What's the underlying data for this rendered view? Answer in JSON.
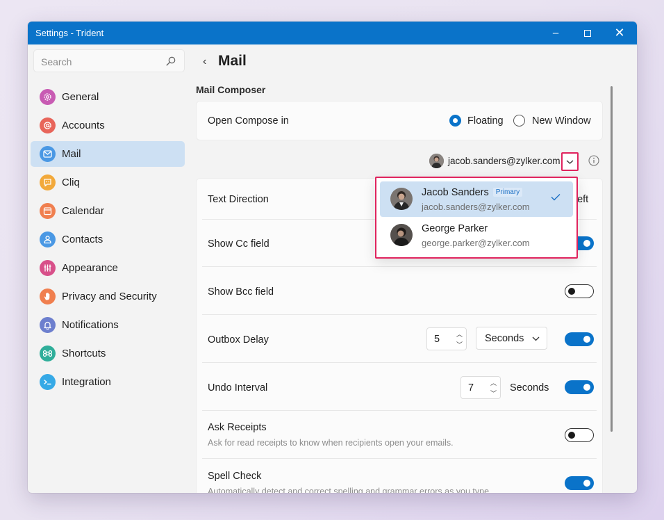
{
  "window": {
    "title": "Settings - Trident",
    "minimize": "–",
    "maximize": "",
    "close": "✕"
  },
  "search": {
    "placeholder": "Search"
  },
  "sidebar": {
    "items": [
      {
        "label": "General",
        "color": "#c85bb3",
        "icon": "gear-icon"
      },
      {
        "label": "Accounts",
        "color": "#e8655a",
        "icon": "at-icon"
      },
      {
        "label": "Mail",
        "color": "#4a98e4",
        "icon": "mail-icon"
      },
      {
        "label": "Cliq",
        "color": "#f2a93b",
        "icon": "chat-icon"
      },
      {
        "label": "Calendar",
        "color": "#f07f4f",
        "icon": "calendar-icon"
      },
      {
        "label": "Contacts",
        "color": "#4a98e4",
        "icon": "contact-icon"
      },
      {
        "label": "Appearance",
        "color": "#d8508a",
        "icon": "appearance-icon"
      },
      {
        "label": "Privacy and Security",
        "color": "#f07f4f",
        "icon": "hand-icon"
      },
      {
        "label": "Notifications",
        "color": "#6d7fce",
        "icon": "bell-icon"
      },
      {
        "label": "Shortcuts",
        "color": "#2fae9a",
        "icon": "command-icon"
      },
      {
        "label": "Integration",
        "color": "#36a9e6",
        "icon": "terminal-icon"
      }
    ],
    "active": "Mail"
  },
  "header": {
    "back": "‹",
    "title": "Mail"
  },
  "section": {
    "title": "Mail Composer"
  },
  "compose": {
    "label": "Open Compose in",
    "options": [
      "Floating",
      "New Window"
    ],
    "selected": "Floating"
  },
  "account": {
    "email": "jacob.sanders@zylker.com"
  },
  "settings": {
    "text_direction": {
      "label": "Text Direction",
      "value": "Left"
    },
    "show_cc": {
      "label": "Show Cc field",
      "on": true
    },
    "show_bcc": {
      "label": "Show Bcc field",
      "on": false
    },
    "outbox_delay": {
      "label": "Outbox Delay",
      "value": "5",
      "unit": "Seconds",
      "on": true
    },
    "undo_interval": {
      "label": "Undo Interval",
      "value": "7",
      "unit": "Seconds",
      "on": true
    },
    "ask_receipts": {
      "label": "Ask Receipts",
      "description": "Ask for read receipts to know when recipients open your emails.",
      "on": false
    },
    "spell_check": {
      "label": "Spell Check",
      "description": "Automatically detect and correct spelling and grammar errors as you type.",
      "on": true
    }
  },
  "dropdown": {
    "accounts": [
      {
        "name": "Jacob Sanders",
        "badge": "Primary",
        "email": "jacob.sanders@zylker.com",
        "selected": true
      },
      {
        "name": "George Parker",
        "email": "george.parker@zylker.com",
        "selected": false
      }
    ]
  },
  "colors": {
    "accent": "#0a73c9",
    "highlight": "#e0245e",
    "active_bg": "#cde0f3"
  }
}
